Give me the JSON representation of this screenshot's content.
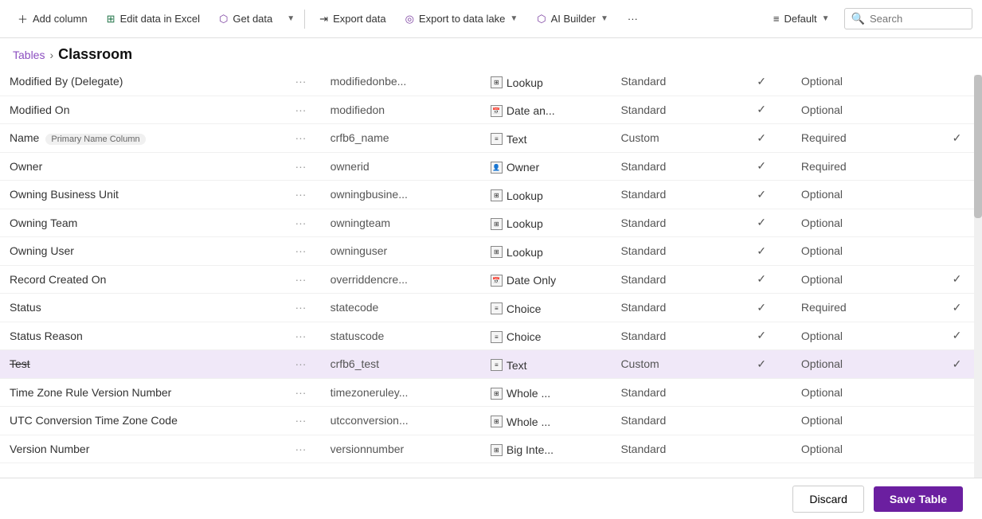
{
  "toolbar": {
    "add_column": "Add column",
    "edit_excel": "Edit data in Excel",
    "get_data": "Get data",
    "dropdown1": "",
    "export_data": "Export data",
    "export_lake": "Export to data lake",
    "ai_builder": "AI Builder",
    "more": "···",
    "default": "Default",
    "search_placeholder": "Search"
  },
  "breadcrumb": {
    "parent": "Tables",
    "separator": "›",
    "current": "Classroom"
  },
  "columns": {
    "headers": []
  },
  "rows": [
    {
      "name": "Modified By (Delegate)",
      "badge": "",
      "dots": "···",
      "schema": "modifiedonbe...",
      "type": "Lookup",
      "custom": "Standard",
      "check1": true,
      "req": "Optional",
      "check2": false
    },
    {
      "name": "Modified On",
      "badge": "",
      "dots": "···",
      "schema": "modifiedon",
      "type": "Date an...",
      "custom": "Standard",
      "check1": true,
      "req": "Optional",
      "check2": false
    },
    {
      "name": "Name",
      "badge": "Primary Name Column",
      "dots": "···",
      "schema": "crfb6_name",
      "type": "Text",
      "custom": "Custom",
      "check1": true,
      "req": "Required",
      "check2": true
    },
    {
      "name": "Owner",
      "badge": "",
      "dots": "···",
      "schema": "ownerid",
      "type": "Owner",
      "custom": "Standard",
      "check1": true,
      "req": "Required",
      "check2": false
    },
    {
      "name": "Owning Business Unit",
      "badge": "",
      "dots": "···",
      "schema": "owningbusine...",
      "type": "Lookup",
      "custom": "Standard",
      "check1": true,
      "req": "Optional",
      "check2": false
    },
    {
      "name": "Owning Team",
      "badge": "",
      "dots": "···",
      "schema": "owningteam",
      "type": "Lookup",
      "custom": "Standard",
      "check1": true,
      "req": "Optional",
      "check2": false
    },
    {
      "name": "Owning User",
      "badge": "",
      "dots": "···",
      "schema": "owninguser",
      "type": "Lookup",
      "custom": "Standard",
      "check1": true,
      "req": "Optional",
      "check2": false
    },
    {
      "name": "Record Created On",
      "badge": "",
      "dots": "···",
      "schema": "overriddencre...",
      "type": "Date Only",
      "custom": "Standard",
      "check1": true,
      "req": "Optional",
      "check2": true
    },
    {
      "name": "Status",
      "badge": "",
      "dots": "···",
      "schema": "statecode",
      "type": "Choice",
      "custom": "Standard",
      "check1": true,
      "req": "Required",
      "check2": true
    },
    {
      "name": "Status Reason",
      "badge": "",
      "dots": "···",
      "schema": "statuscode",
      "type": "Choice",
      "custom": "Standard",
      "check1": true,
      "req": "Optional",
      "check2": true
    },
    {
      "name": "Test",
      "badge": "",
      "dots": "···",
      "schema": "crfb6_test",
      "type": "Text",
      "custom": "Custom",
      "check1": true,
      "req": "Optional",
      "check2": true,
      "selected": true,
      "strikethrough": true
    },
    {
      "name": "Time Zone Rule Version Number",
      "badge": "",
      "dots": "···",
      "schema": "timezoneruley...",
      "type": "Whole ...",
      "custom": "Standard",
      "check1": false,
      "req": "Optional",
      "check2": false
    },
    {
      "name": "UTC Conversion Time Zone Code",
      "badge": "",
      "dots": "···",
      "schema": "utcconversion...",
      "type": "Whole ...",
      "custom": "Standard",
      "check1": false,
      "req": "Optional",
      "check2": false
    },
    {
      "name": "Version Number",
      "badge": "",
      "dots": "···",
      "schema": "versionnumber",
      "type": "Big Inte...",
      "custom": "Standard",
      "check1": false,
      "req": "Optional",
      "check2": false
    }
  ],
  "footer": {
    "discard": "Discard",
    "save": "Save Table"
  },
  "type_icons": {
    "Lookup": "⊞",
    "Date an...": "📅",
    "Text": "≡≡",
    "Owner": "👤",
    "Date Only": "📅",
    "Choice": "≡",
    "Whole ...": "⊞",
    "Big Inte...": "⊞"
  }
}
